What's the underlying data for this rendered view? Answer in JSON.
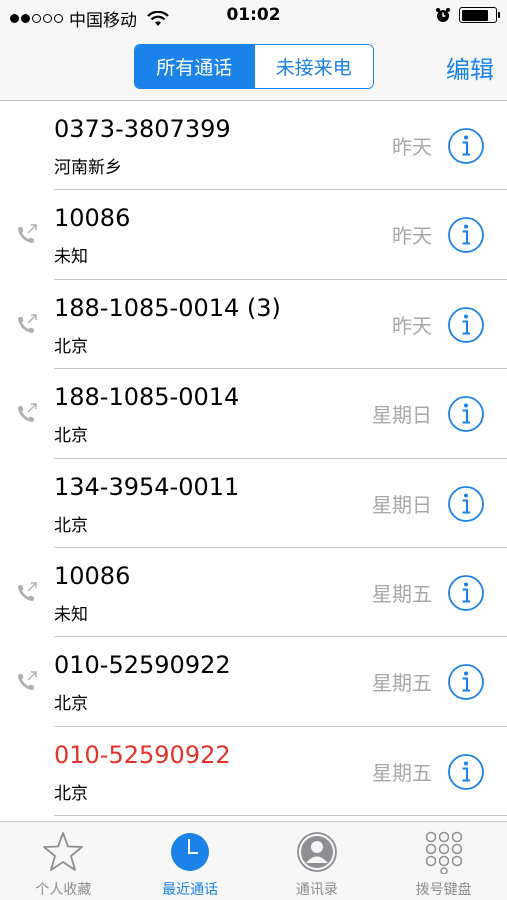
{
  "status_bar": {
    "carrier": "中国移动",
    "time": "01:02",
    "signal_dots_filled": 2,
    "signal_dots_total": 5,
    "battery_level": 0.8
  },
  "nav": {
    "segments": [
      "所有通话",
      "未接来电"
    ],
    "selected_segment": "所有通话",
    "edit_label": "编辑"
  },
  "calls": [
    {
      "number": "0373-3807399",
      "location": "河南新乡",
      "date": "昨天",
      "outgoing": false,
      "missed": false
    },
    {
      "number": "10086",
      "location": "未知",
      "date": "昨天",
      "outgoing": true,
      "missed": false
    },
    {
      "number": "188-1085-0014  (3)",
      "location": "北京",
      "date": "昨天",
      "outgoing": true,
      "missed": false
    },
    {
      "number": "188-1085-0014",
      "location": "北京",
      "date": "星期日",
      "outgoing": true,
      "missed": false
    },
    {
      "number": "134-3954-0011",
      "location": "北京",
      "date": "星期日",
      "outgoing": false,
      "missed": false
    },
    {
      "number": "10086",
      "location": "未知",
      "date": "星期五",
      "outgoing": true,
      "missed": false
    },
    {
      "number": "010-52590922",
      "location": "北京",
      "date": "星期五",
      "outgoing": true,
      "missed": false
    },
    {
      "number": "010-52590922",
      "location": "北京",
      "date": "星期五",
      "outgoing": false,
      "missed": true
    }
  ],
  "tabs": [
    {
      "label": "个人收藏",
      "icon": "star-icon",
      "active": false
    },
    {
      "label": "最近通话",
      "icon": "clock-icon",
      "active": true
    },
    {
      "label": "通讯录",
      "icon": "contacts-icon",
      "active": false
    },
    {
      "label": "拨号键盘",
      "icon": "keypad-icon",
      "active": false
    }
  ],
  "colors": {
    "accent": "#1a82e8",
    "missed": "#e2332b",
    "secondary_text": "#a8a8a8"
  }
}
